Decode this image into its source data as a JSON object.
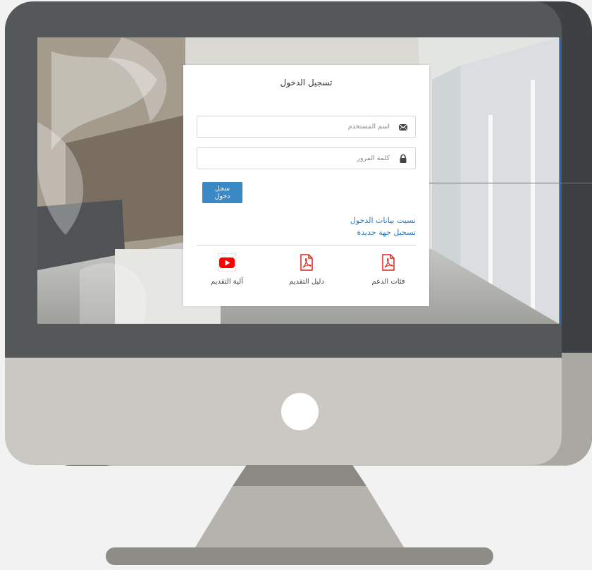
{
  "login": {
    "title": "تسجيل الدخول",
    "username_placeholder": "اسم المستخدم",
    "password_placeholder": "كلمة المرور",
    "submit_label": "سجل دخول",
    "forgot_link": "نسيت بيانات الدخول",
    "register_link": "تسجيل جهة جديدة"
  },
  "resources": [
    {
      "label": "فئات الدعم",
      "icon": "pdf-icon"
    },
    {
      "label": "دليل التقديم",
      "icon": "pdf-icon"
    },
    {
      "label": "آلية التقديم",
      "icon": "youtube-icon"
    }
  ],
  "colors": {
    "primary_button": "#3a88c4",
    "link": "#2e7bbf",
    "pdf_icon": "#e0241b",
    "youtube_icon": "#ff0000",
    "bezel": "#545859",
    "chin": "#cac8c2"
  }
}
